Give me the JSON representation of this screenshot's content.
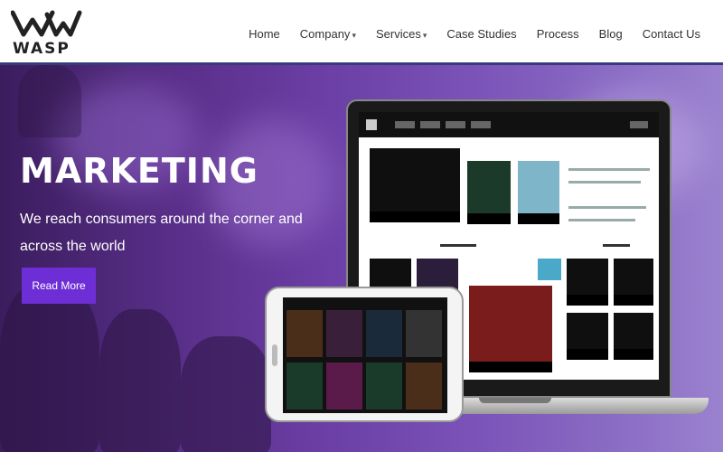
{
  "brand": {
    "name": "WASP"
  },
  "nav": {
    "items": [
      {
        "label": "Home",
        "has_dropdown": false
      },
      {
        "label": "Company",
        "has_dropdown": true
      },
      {
        "label": "Services",
        "has_dropdown": true
      },
      {
        "label": "Case Studies",
        "has_dropdown": false
      },
      {
        "label": "Process",
        "has_dropdown": false
      },
      {
        "label": "Blog",
        "has_dropdown": false
      },
      {
        "label": "Contact Us",
        "has_dropdown": false
      }
    ],
    "caret": "▾"
  },
  "hero": {
    "title": "MARKETING",
    "subtitle": "We reach consumers around the corner and across the world",
    "cta_label": "Read More"
  },
  "colors": {
    "accent": "#6d2ed6",
    "hero_purple": "#6b3fa5",
    "header_border": "#3a3a7a"
  },
  "icons": [
    "wasp-logo-icon",
    "caret-down-icon"
  ]
}
